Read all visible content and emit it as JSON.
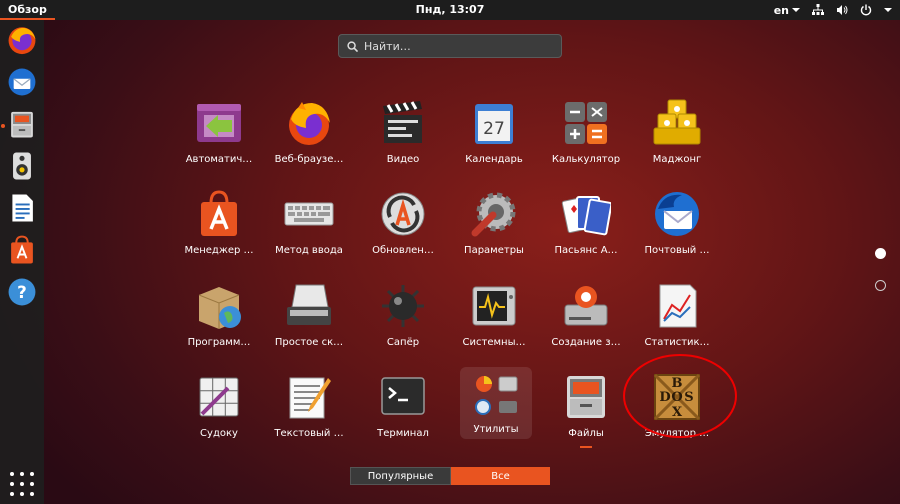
{
  "top_panel": {
    "activities": "Обзор",
    "clock": "Пнд, 13:07",
    "language": "en"
  },
  "search": {
    "placeholder": "Найти…"
  },
  "apps": [
    {
      "label": "Автоматич…",
      "icon": "app-window-green-arrow-icon"
    },
    {
      "label": "Веб-браузе…",
      "icon": "firefox-icon"
    },
    {
      "label": "Видео",
      "icon": "clapperboard-icon"
    },
    {
      "label": "Календарь",
      "icon": "calendar-icon",
      "day": "27"
    },
    {
      "label": "Калькулятор",
      "icon": "calculator-icon"
    },
    {
      "label": "Маджонг",
      "icon": "mahjong-icon"
    },
    {
      "label": "Менеджер …",
      "icon": "software-bag-icon"
    },
    {
      "label": "Метод ввода",
      "icon": "keyboard-icon"
    },
    {
      "label": "Обновлен…",
      "icon": "update-icon"
    },
    {
      "label": "Параметры",
      "icon": "settings-gear-icon"
    },
    {
      "label": "Пасьянс А…",
      "icon": "cards-icon"
    },
    {
      "label": "Почтовый …",
      "icon": "thunderbird-icon"
    },
    {
      "label": "Программ…",
      "icon": "package-globe-icon"
    },
    {
      "label": "Простое ск…",
      "icon": "scanner-icon"
    },
    {
      "label": "Сапёр",
      "icon": "mine-icon"
    },
    {
      "label": "Системны…",
      "icon": "system-monitor-icon"
    },
    {
      "label": "Создание з…",
      "icon": "usb-disk-icon"
    },
    {
      "label": "Статистик…",
      "icon": "statistics-chart-icon"
    },
    {
      "label": "Судоку",
      "icon": "sudoku-icon"
    },
    {
      "label": "Текстовый …",
      "icon": "text-editor-icon"
    },
    {
      "label": "Терминал",
      "icon": "terminal-icon"
    },
    {
      "label": "Утилиты",
      "icon": "utilities-folder-icon"
    },
    {
      "label": "Файлы",
      "icon": "file-cabinet-icon"
    },
    {
      "label": "Эмулятор …",
      "icon": "dosbox-icon",
      "letters": [
        "B",
        "O",
        "D",
        "S",
        "X"
      ]
    }
  ],
  "dock": [
    {
      "icon": "firefox-icon"
    },
    {
      "icon": "thunderbird-icon"
    },
    {
      "icon": "file-cabinet-icon"
    },
    {
      "icon": "speaker-icon"
    },
    {
      "icon": "writer-document-icon"
    },
    {
      "icon": "software-bag-icon"
    },
    {
      "icon": "help-icon",
      "glyph": "?"
    }
  ],
  "toggle": {
    "popular": "Популярные",
    "all": "Все"
  },
  "colors": {
    "accent": "#e95420",
    "panel": "#1d1d1d",
    "annotation": "#e00000"
  }
}
